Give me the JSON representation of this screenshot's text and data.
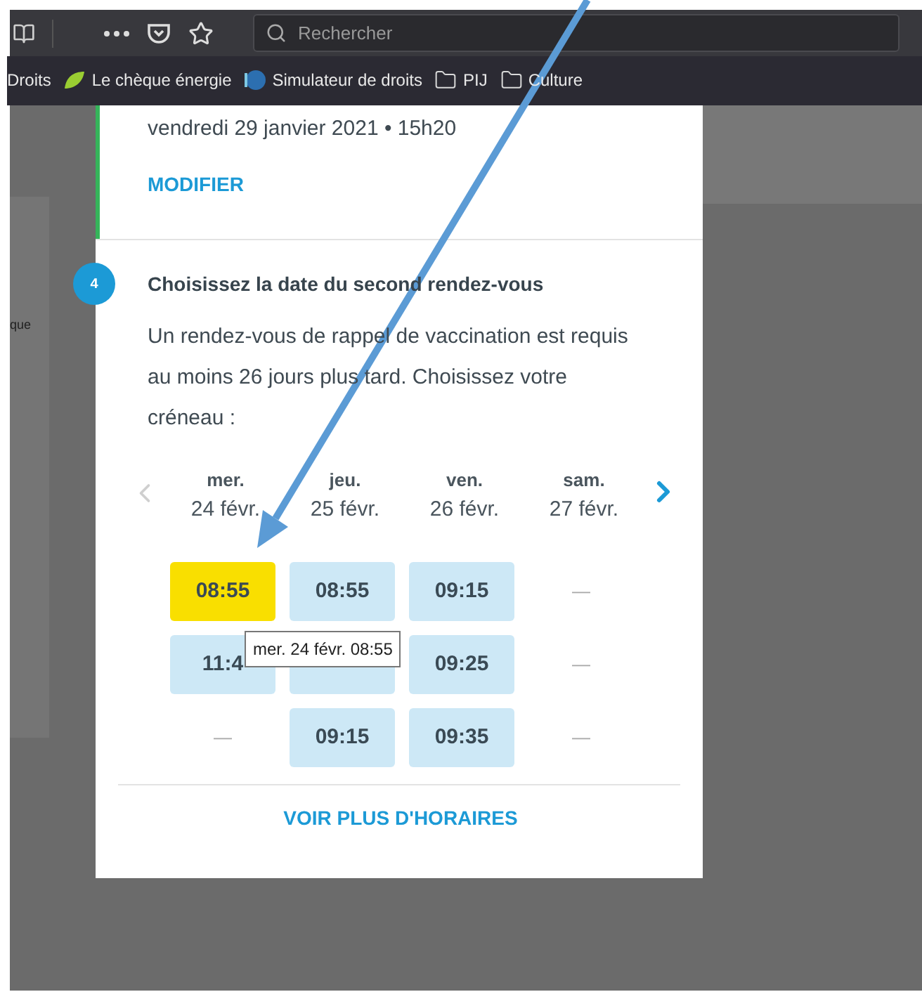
{
  "browser": {
    "search_placeholder": "Rechercher",
    "bookmarks": [
      {
        "label": "Droits",
        "kind": "plain"
      },
      {
        "label": "Le chèque énergie",
        "kind": "leaf"
      },
      {
        "label": "Simulateur de droits",
        "kind": "globe"
      },
      {
        "label": "PIJ",
        "kind": "folder"
      },
      {
        "label": "Culture",
        "kind": "folder"
      }
    ]
  },
  "background": {
    "text": "que"
  },
  "appointment": {
    "date_text": "vendredi 29 janvier 2021 • 15h20",
    "modify_link": "MODIFIER"
  },
  "step": {
    "number": "4",
    "title": "Choisissez la date du second rendez-vous",
    "description": "Un rendez-vous de rappel de vaccination est requis au moins 26 jours plus tard. Choisissez votre créneau :"
  },
  "calendar": {
    "prev_disabled": true,
    "next_disabled": false,
    "days": [
      {
        "weekday": "mer.",
        "date": "24 févr.",
        "slots": [
          {
            "kind": "slot",
            "time": "08:55",
            "selected": true
          },
          {
            "kind": "slot",
            "time": "11:4",
            "selected": false
          },
          {
            "kind": "empty",
            "time": "—"
          }
        ]
      },
      {
        "weekday": "jeu.",
        "date": "25 févr.",
        "slots": [
          {
            "kind": "slot",
            "time": "08:55",
            "selected": false
          },
          {
            "kind": "slot",
            "selected": false
          },
          {
            "kind": "slot",
            "time": "09:15",
            "selected": false
          }
        ]
      },
      {
        "weekday": "ven.",
        "date": "26 févr.",
        "slots": [
          {
            "kind": "slot",
            "time": "09:15",
            "selected": false
          },
          {
            "kind": "slot",
            "time": "09:25",
            "selected": false
          },
          {
            "kind": "slot",
            "time": "09:35",
            "selected": false
          }
        ]
      },
      {
        "weekday": "sam.",
        "date": "27 févr.",
        "slots": [
          {
            "kind": "empty",
            "time": "—"
          },
          {
            "kind": "empty",
            "time": "—"
          },
          {
            "kind": "empty",
            "time": "—"
          }
        ]
      }
    ]
  },
  "tooltip": {
    "text": "mer. 24 févr. 08:55"
  },
  "more_link": "VOIR PLUS D'HORAIRES"
}
